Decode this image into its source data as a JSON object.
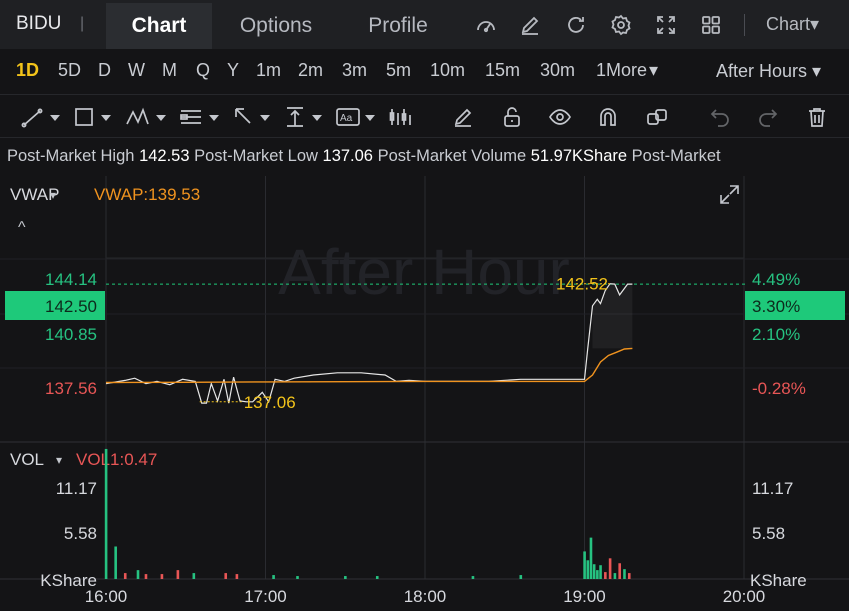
{
  "header": {
    "ticker": "BIDU",
    "separator": "|",
    "tabs": [
      {
        "label": "Chart",
        "active": true
      },
      {
        "label": "Options",
        "active": false
      },
      {
        "label": "Profile",
        "active": false
      }
    ],
    "icons": [
      "speedometer-icon",
      "pencil-icon",
      "refresh-icon",
      "gear-icon",
      "expand-icon",
      "grid-icon"
    ],
    "chart_menu_label": "Chart▾"
  },
  "intervals": {
    "items": [
      "1D",
      "5D",
      "D",
      "W",
      "M",
      "Q",
      "Y",
      "1m",
      "2m",
      "3m",
      "5m",
      "10m",
      "15m",
      "30m",
      "1More"
    ],
    "more_caret": "▾",
    "active": "1D",
    "session_label": "After Hours ▾"
  },
  "drawing_tools": [
    "line-tool-icon",
    "rectangle-tool-icon",
    "pattern-tool-icon",
    "fib-tool-icon",
    "arrow-tool-icon",
    "measure-tool-icon",
    "text-tool-icon",
    "indicator-tool-icon",
    "pen-icon",
    "unlock-icon",
    "eye-icon",
    "magnet-icon",
    "duplicate-icon",
    "undo-icon",
    "redo-icon",
    "trash-icon"
  ],
  "stats": {
    "high_label": "Post-Market High",
    "high_value": "142.53",
    "low_label": "Post-Market Low",
    "low_value": "137.06",
    "volume_label": "Post-Market Volume",
    "volume_value": "51.97KShare",
    "tail_label": "Post-Market"
  },
  "colors": {
    "accent": "#f2c31a",
    "up": "#26c281",
    "down": "#e85656",
    "vwap": "#f0931f",
    "price_line": "#e6e6e6",
    "current_tag": "#1ec97a"
  },
  "chart_data": [
    {
      "type": "line",
      "panel": "price",
      "indicator_label": "VWAP",
      "indicator_caret": "▾",
      "vwap_label": "VWAP:139.53",
      "watermark": "After Hour",
      "collapse_glyph": "^",
      "y_ticks_left": [
        "144.14",
        "142.50",
        "140.85",
        "137.56"
      ],
      "y_ticks_right": [
        "4.49%",
        "3.30%",
        "2.10%",
        "-0.28%"
      ],
      "current_price_tag": "142.50",
      "current_pct_tag": "3.30%",
      "high_annotation": "142.52",
      "low_annotation": "137.06",
      "ylim": [
        135.2,
        147.5
      ],
      "x_range_hours": [
        16.0,
        20.0
      ],
      "series": [
        {
          "name": "Price",
          "x": [
            16.0,
            16.12,
            16.18,
            16.25,
            16.32,
            16.4,
            16.48,
            16.56,
            16.6,
            16.63,
            16.66,
            16.7,
            16.74,
            16.77,
            16.8,
            16.84,
            16.88,
            16.92,
            16.98,
            17.02,
            17.06,
            17.12,
            17.18,
            17.3,
            17.45,
            17.6,
            17.75,
            17.82,
            17.9,
            18.0,
            18.2,
            18.4,
            18.6,
            18.75,
            18.85,
            19.0,
            19.02,
            19.05,
            19.08,
            19.1,
            19.13,
            19.16,
            19.19,
            19.22,
            19.27,
            19.3
          ],
          "y": [
            137.9,
            138.05,
            138.15,
            137.9,
            138.0,
            137.85,
            138.1,
            138.0,
            137.0,
            137.0,
            137.9,
            137.1,
            138.1,
            137.0,
            138.2,
            137.1,
            137.06,
            137.06,
            137.5,
            137.06,
            138.1,
            138.0,
            138.15,
            138.3,
            138.4,
            138.4,
            138.3,
            138.0,
            138.05,
            138.0,
            138.0,
            138.0,
            138.1,
            138.1,
            138.1,
            138.1,
            139.5,
            141.5,
            141.8,
            141.6,
            142.2,
            142.52,
            142.5,
            142.0,
            142.5,
            142.5
          ]
        },
        {
          "name": "VWAP",
          "x": [
            16.0,
            16.5,
            17.0,
            17.5,
            18.0,
            18.5,
            19.0,
            19.05,
            19.1,
            19.15,
            19.2,
            19.25,
            19.3
          ],
          "y": [
            137.95,
            137.96,
            137.98,
            137.99,
            138.0,
            138.0,
            138.0,
            138.3,
            138.9,
            139.2,
            139.35,
            139.5,
            139.53
          ]
        }
      ]
    },
    {
      "type": "bar",
      "panel": "volume",
      "indicator_label": "VOL",
      "indicator_caret": "▾",
      "vol_label": "VOL1:0.47",
      "y_ticks_left": [
        "11.17",
        "5.58",
        "KShare"
      ],
      "y_ticks_right": [
        "11.17",
        "5.58",
        "KShare"
      ],
      "ylim": [
        0,
        13.5
      ],
      "x_ticks": [
        "16:00",
        "17:00",
        "18:00",
        "19:00",
        "20:00"
      ],
      "series": [
        {
          "name": "VOL",
          "x": [
            16.0,
            16.06,
            16.12,
            16.2,
            16.25,
            16.35,
            16.45,
            16.55,
            16.75,
            16.82,
            17.05,
            17.2,
            17.5,
            17.7,
            18.3,
            18.6,
            19.0,
            19.02,
            19.04,
            19.06,
            19.08,
            19.1,
            19.13,
            19.16,
            19.19,
            19.22,
            19.25,
            19.28
          ],
          "values": [
            13.2,
            3.3,
            0.6,
            0.9,
            0.5,
            0.5,
            0.9,
            0.6,
            0.6,
            0.5,
            0.4,
            0.3,
            0.3,
            0.3,
            0.3,
            0.4,
            2.8,
            1.9,
            4.2,
            1.5,
            0.9,
            1.4,
            0.7,
            2.1,
            0.6,
            1.6,
            1.0,
            0.6
          ],
          "colors": [
            "up",
            "up",
            "down",
            "up",
            "down",
            "down",
            "down",
            "up",
            "down",
            "down",
            "up",
            "up",
            "up",
            "up",
            "up",
            "up",
            "up",
            "up",
            "up",
            "up",
            "up",
            "up",
            "down",
            "down",
            "up",
            "down",
            "up",
            "down"
          ]
        }
      ]
    }
  ]
}
